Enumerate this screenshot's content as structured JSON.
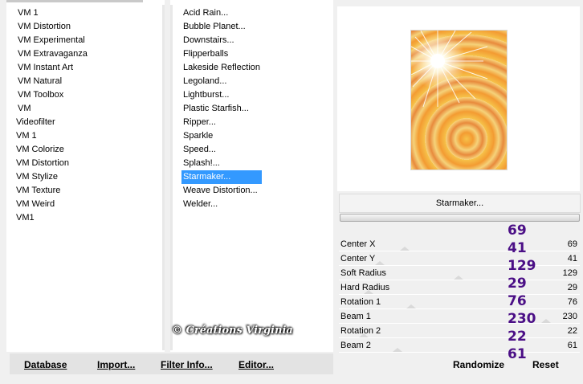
{
  "categories": {
    "items": [
      "VM 1",
      "VM Distortion",
      "VM Experimental",
      "VM Extravaganza",
      "VM Instant Art",
      "VM Natural",
      "VM Toolbox",
      "VM",
      "Videofilter",
      "VM 1",
      "VM Colorize",
      "VM Distortion",
      "VM Stylize",
      "VM Texture",
      "VM Weird",
      "VM1"
    ]
  },
  "filters": {
    "items": [
      "Acid Rain...",
      "Bubble Planet...",
      "Downstairs...",
      "Flipperballs",
      "Lakeside Reflection",
      "Legoland...",
      "Lightburst...",
      "Plastic Starfish...",
      "Ripper...",
      "Sparkle",
      "Speed...",
      "Splash!...",
      "Starmaker...",
      "Weave Distortion...",
      "Welder..."
    ],
    "selected": "Starmaker..."
  },
  "filter_title": "Starmaker...",
  "params": [
    {
      "label": "Center X",
      "value": "69",
      "level": 0.27
    },
    {
      "label": "Center Y",
      "value": "41",
      "level": 0.16
    },
    {
      "label": "Soft Radius",
      "value": "129",
      "level": 0.51
    },
    {
      "label": "Hard Radius",
      "value": "29",
      "level": 0.11
    },
    {
      "label": "Rotation 1",
      "value": "76",
      "level": 0.3
    },
    {
      "label": "Beam 1",
      "value": "230",
      "level": 0.9
    },
    {
      "label": "Rotation 2",
      "value": "22",
      "level": 0.09
    },
    {
      "label": "Beam 2",
      "value": "61",
      "level": 0.24
    }
  ],
  "annotations": [
    "69",
    "41",
    "129",
    "29",
    "76",
    "230",
    "22",
    "61"
  ],
  "watermark": "© Créations Virginia",
  "buttons": {
    "database": "Database",
    "import": "Import...",
    "filter_info": "Filter Info...",
    "editor": "Editor...",
    "randomize": "Randomize",
    "reset": "Reset"
  },
  "colors": {
    "selection": "#3399ff",
    "annotation": "#4b0f86"
  }
}
